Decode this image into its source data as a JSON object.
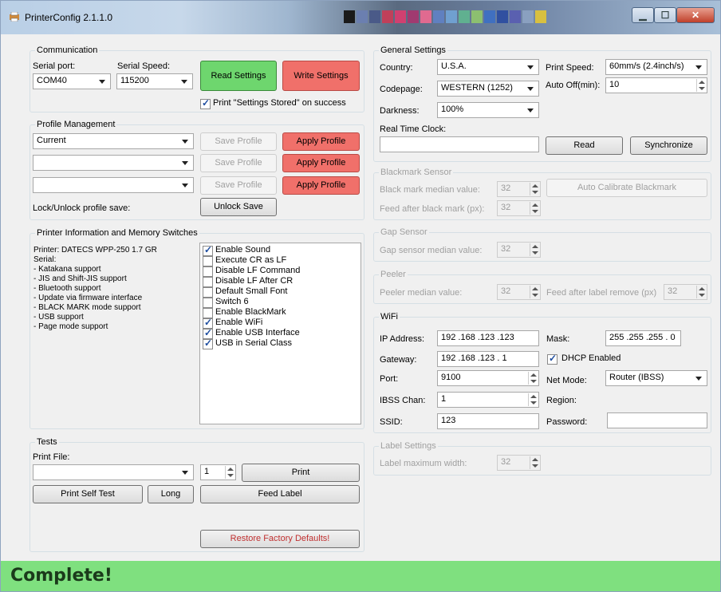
{
  "window": {
    "title": "PrinterConfig 2.1.1.0"
  },
  "communication": {
    "group": "Communication",
    "serial_port_label": "Serial port:",
    "serial_port": "COM40",
    "serial_speed_label": "Serial Speed:",
    "serial_speed": "115200",
    "read_settings": "Read Settings",
    "write_settings": "Write Settings",
    "print_stored": "Print \"Settings Stored\" on success"
  },
  "profile": {
    "group": "Profile Management",
    "profile1": "Current",
    "save_profile": "Save Profile",
    "apply_profile": "Apply Profile",
    "lock_label": "Lock/Unlock profile save:",
    "unlock_save": "Unlock Save"
  },
  "printer_info": {
    "group": "Printer Information and Memory Switches",
    "lines": [
      "Printer: DATECS WPP-250 1.7 GR",
      "Serial:",
      "- Katakana support",
      "- JIS and Shift-JIS support",
      "- Bluetooth support",
      "- Update via firmware interface",
      "- BLACK MARK mode support",
      "- USB support",
      "- Page mode support"
    ],
    "switches": [
      {
        "label": "Enable Sound",
        "checked": true
      },
      {
        "label": "Execute CR as LF",
        "checked": false
      },
      {
        "label": "Disable LF Command",
        "checked": false
      },
      {
        "label": "Disable LF After CR",
        "checked": false
      },
      {
        "label": "Default Small Font",
        "checked": false
      },
      {
        "label": "Switch 6",
        "checked": false
      },
      {
        "label": "Enable BlackMark",
        "checked": false
      },
      {
        "label": "Enable WiFi",
        "checked": true
      },
      {
        "label": "Enable USB Interface",
        "checked": true
      },
      {
        "label": "USB in Serial Class",
        "checked": true
      }
    ]
  },
  "tests": {
    "group": "Tests",
    "print_file_label": "Print File:",
    "copies": "1",
    "print": "Print",
    "self_test": "Print Self Test",
    "long": "Long",
    "feed_label": "Feed Label",
    "restore": "Restore Factory Defaults!"
  },
  "general": {
    "group": "General Settings",
    "country_label": "Country:",
    "country": "U.S.A.",
    "codepage_label": "Codepage:",
    "codepage": "WESTERN (1252)",
    "darkness_label": "Darkness:",
    "darkness": "100%",
    "print_speed_label": "Print Speed:",
    "print_speed": "60mm/s (2.4inch/s)",
    "auto_off_label": "Auto Off(min):",
    "auto_off": "10",
    "rtc_label": "Real Time Clock:",
    "rtc_value": "",
    "read": "Read",
    "synchronize": "Synchronize"
  },
  "blackmark": {
    "group": "Blackmark Sensor",
    "median_label": "Black mark median value:",
    "median": "32",
    "feed_label": "Feed after black mark (px):",
    "feed": "32",
    "auto_calibrate": "Auto Calibrate Blackmark"
  },
  "gap": {
    "group": "Gap Sensor",
    "median_label": "Gap sensor median value:",
    "median": "32"
  },
  "peeler": {
    "group": "Peeler",
    "median_label": "Peeler median value:",
    "median": "32",
    "feed_label": "Feed after label remove (px)",
    "feed": "32"
  },
  "wifi": {
    "group": "WiFi",
    "ip_label": "IP Address:",
    "ip": "192 .168 .123 .123",
    "mask_label": "Mask:",
    "mask": "255 .255 .255 . 0",
    "gateway_label": "Gateway:",
    "gateway": "192 .168 .123 . 1",
    "dhcp": "DHCP Enabled",
    "port_label": "Port:",
    "port": "9100",
    "net_mode_label": "Net Mode:",
    "net_mode": "Router (IBSS)",
    "ibss_label": "IBSS Chan:",
    "ibss": "1",
    "region_label": "Region:",
    "ssid_label": "SSID:",
    "ssid": "123",
    "password_label": "Password:",
    "password": ""
  },
  "label_settings": {
    "group": "Label Settings",
    "max_width_label": "Label maximum width:",
    "max_width": "32"
  },
  "status": {
    "text": "Complete!"
  }
}
